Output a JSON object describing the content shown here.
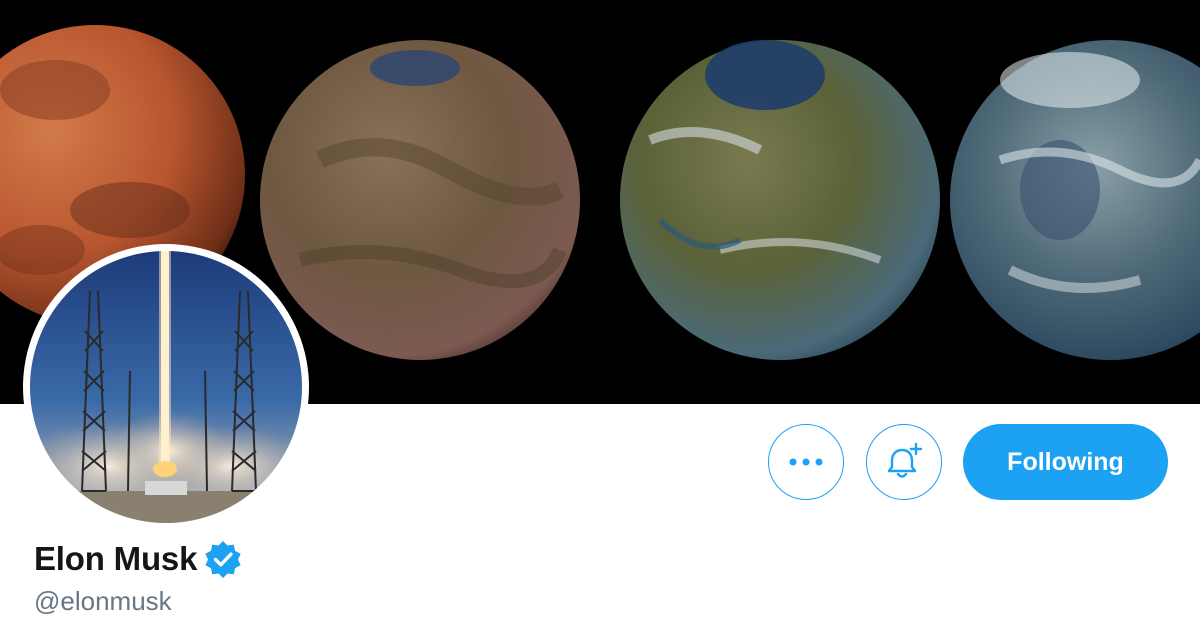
{
  "profile": {
    "name": "Elon Musk",
    "handle": "@elonmusk",
    "verified": true
  },
  "actions": {
    "more_icon": "ellipsis-icon",
    "notify_icon": "bell-plus-icon",
    "follow_label": "Following"
  },
  "banner": {
    "image": "mars-terraforming-stages"
  },
  "avatar": {
    "image": "rocket-launch"
  },
  "colors": {
    "accent": "#1da1f2",
    "name_text": "#14171a",
    "handle_text": "#657786",
    "banner_bg": "#000000"
  }
}
